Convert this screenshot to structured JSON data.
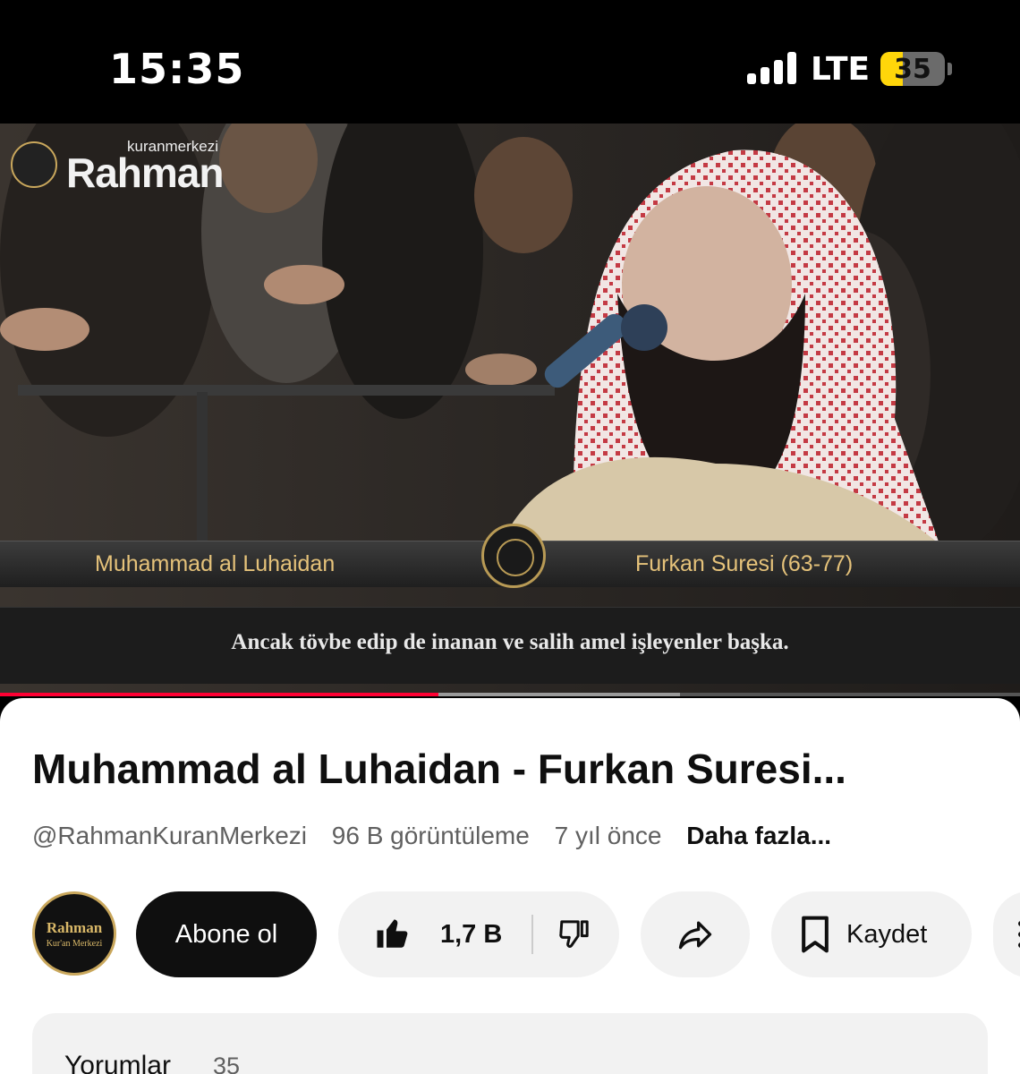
{
  "status_bar": {
    "time": "15:35",
    "network": "LTE",
    "battery_percent": "35",
    "battery_level": 0.35,
    "signal_bars": 4
  },
  "video": {
    "watermark_small": "kuranmerkezi",
    "watermark_brand": "Rahman",
    "reciter": "Muhammad al Luhaidan",
    "surah": "Furkan Suresi (63-77)",
    "subtitle": "Ancak tövbe edip de inanan ve salih amel işleyenler başka.",
    "progress_played": 0.43,
    "progress_buffered": 0.667
  },
  "details": {
    "title": "Muhammad al Luhaidan - Furkan Suresi...",
    "channel_handle": "@RahmanKuranMerkezi",
    "views": "96 B görüntüleme",
    "age": "7 yıl önce",
    "more": "Daha fazla..."
  },
  "channel": {
    "avatar_text": "Rahman",
    "avatar_subtext": "Kur'an Merkezi",
    "subscribe_label": "Abone ol"
  },
  "actions": {
    "like_count": "1,7 B",
    "save_label": "Kaydet",
    "icons": [
      "like-icon",
      "dislike-icon",
      "share-icon",
      "bookmark-icon",
      "more-icon"
    ]
  },
  "comments": {
    "label": "Yorumlar",
    "count": "35"
  },
  "colors": {
    "accent": "#ff0033",
    "battery": "#ffd60a",
    "gold": "#e5c27a"
  }
}
